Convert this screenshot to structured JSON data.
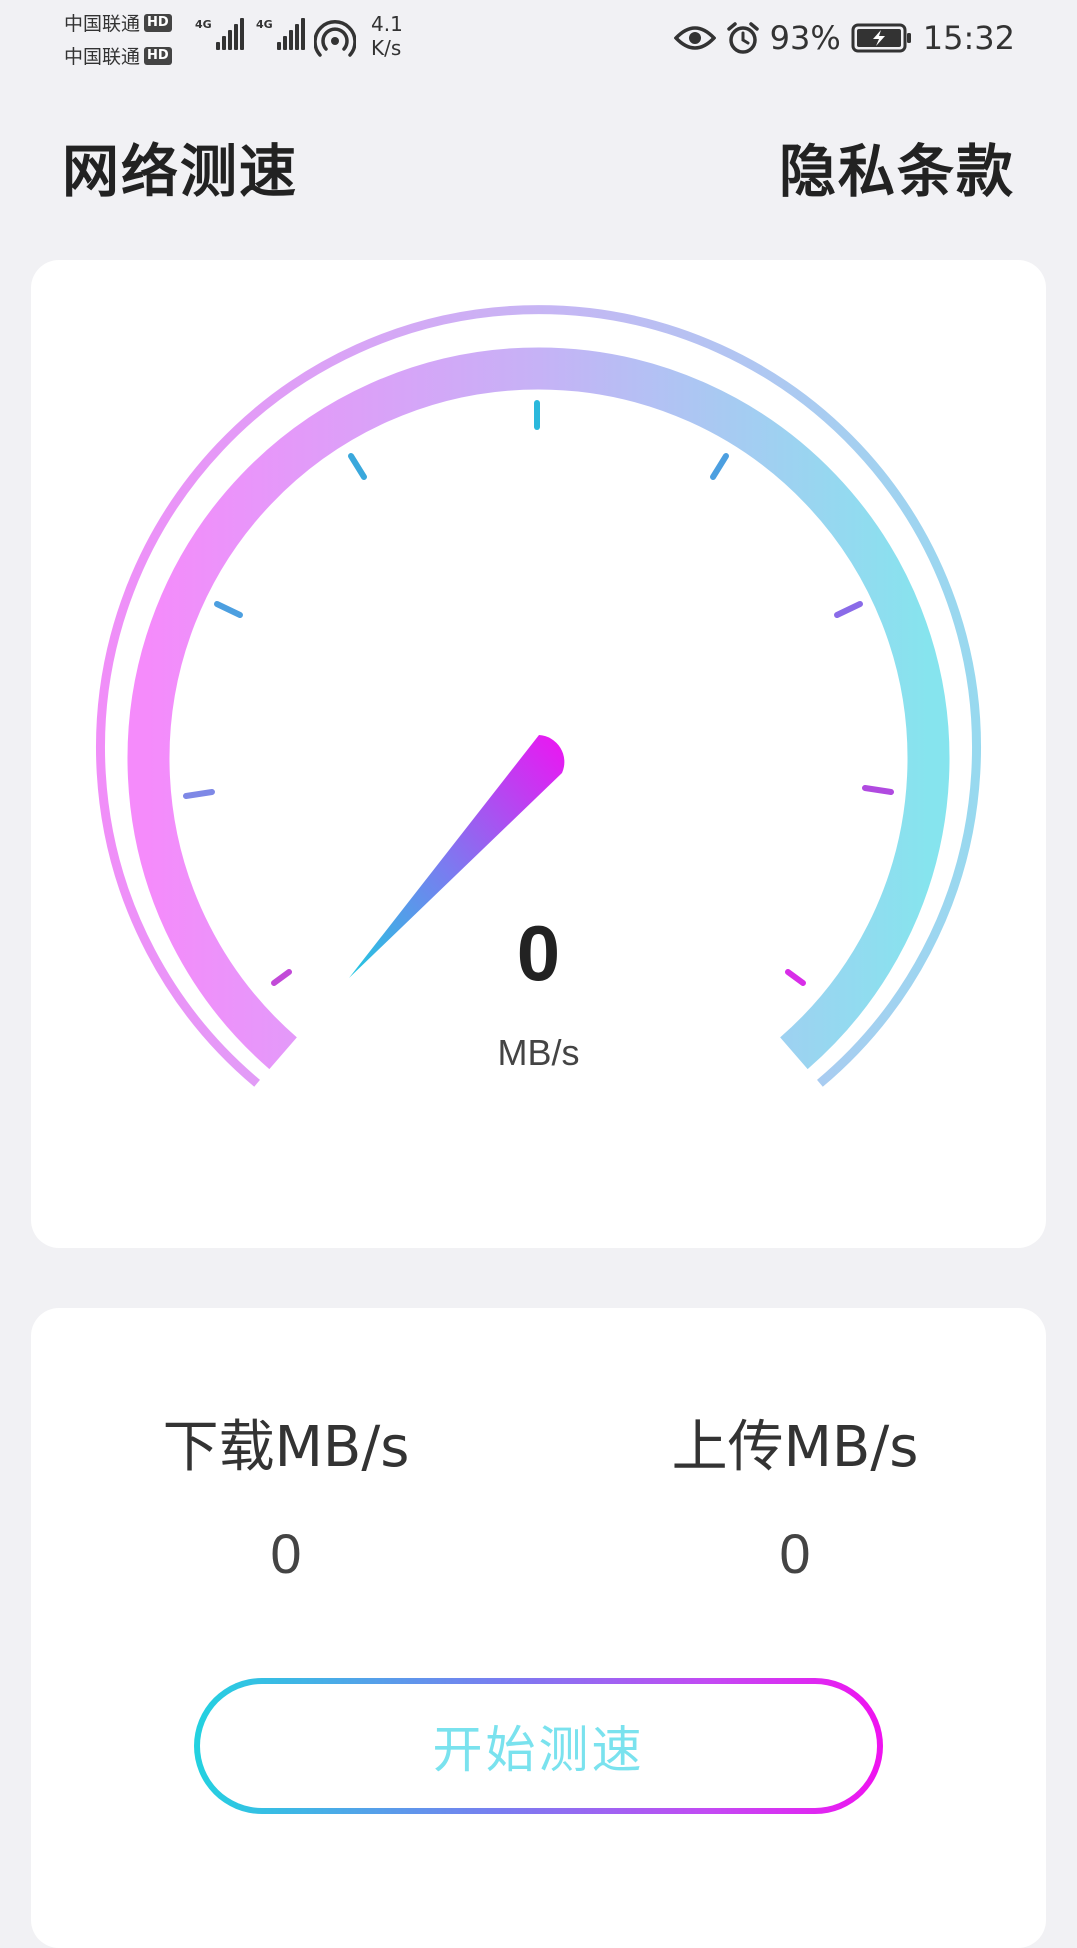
{
  "status_bar": {
    "carrier_1": "中国联通",
    "carrier_2": "中国联通",
    "hd_badge": "HD",
    "network_type": "4G",
    "net_speed_value": "4.1",
    "net_speed_unit": "K/s",
    "battery": "93%",
    "time": "15:32"
  },
  "header": {
    "title": "网络测速",
    "privacy_link": "隐私条款"
  },
  "gauge": {
    "speed_value": "0",
    "unit": "MB/s",
    "needle_colors": [
      "#22c8e0",
      "#7a7cf0",
      "#ee14f2"
    ],
    "arc_colors": [
      "#f58bfb",
      "#c6b2f6",
      "#86e4ee"
    ]
  },
  "results": {
    "download_label": "下载MB/s",
    "download_value": "0",
    "upload_label": "上传MB/s",
    "upload_value": "0"
  },
  "start_button": {
    "label": "开始测速"
  }
}
